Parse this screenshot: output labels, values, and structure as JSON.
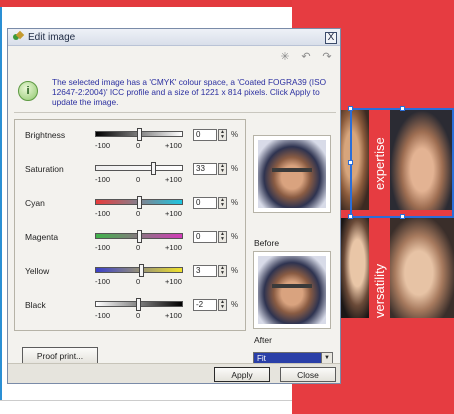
{
  "dialog": {
    "title": "Edit image",
    "close_glyph": "X",
    "info": "The selected image has a 'CMYK' colour space, a 'Coated FOGRA39 (ISO 12647-2:2004)' ICC profile and a size of 1221 x 814 pixels. Click Apply to update the image.",
    "info_icon_glyph": "i",
    "adjustments": [
      {
        "label": "Brightness",
        "value": "0",
        "min": "-100",
        "mid": "0",
        "max": "+100",
        "level": 0.5,
        "gradient_from": "#000000",
        "gradient_to": "#ffffff"
      },
      {
        "label": "Saturation",
        "value": "33",
        "min": "-100",
        "mid": "0",
        "max": "+100",
        "level": 0.66,
        "gradient_from": "#eeeeee",
        "gradient_to": "#ffffff"
      },
      {
        "label": "Cyan",
        "value": "0",
        "min": "-100",
        "mid": "0",
        "max": "+100",
        "level": 0.5,
        "gradient_from": "#e83c3c",
        "gradient_to": "#1ec6e0"
      },
      {
        "label": "Magenta",
        "value": "0",
        "min": "-100",
        "mid": "0",
        "max": "+100",
        "level": 0.5,
        "gradient_from": "#3fb34a",
        "gradient_to": "#d23bb8"
      },
      {
        "label": "Yellow",
        "value": "3",
        "min": "-100",
        "mid": "0",
        "max": "+100",
        "level": 0.52,
        "gradient_from": "#3a3fc9",
        "gradient_to": "#f0e22a"
      },
      {
        "label": "Black",
        "value": "-2",
        "min": "-100",
        "mid": "0",
        "max": "+100",
        "level": 0.49,
        "gradient_from": "#ffffff",
        "gradient_to": "#000000"
      }
    ],
    "percent_sign": "%",
    "proof_button": "Proof print...",
    "before_label": "Before",
    "after_label": "After",
    "fit_value": "Fit",
    "apply_button": "Apply",
    "close_button": "Close",
    "toolbar_icons": [
      "reset-icon",
      "undo-icon",
      "redo-icon"
    ]
  },
  "background": {
    "word1": "expertise",
    "word2": "versatility",
    "accent": "#e63c41"
  }
}
